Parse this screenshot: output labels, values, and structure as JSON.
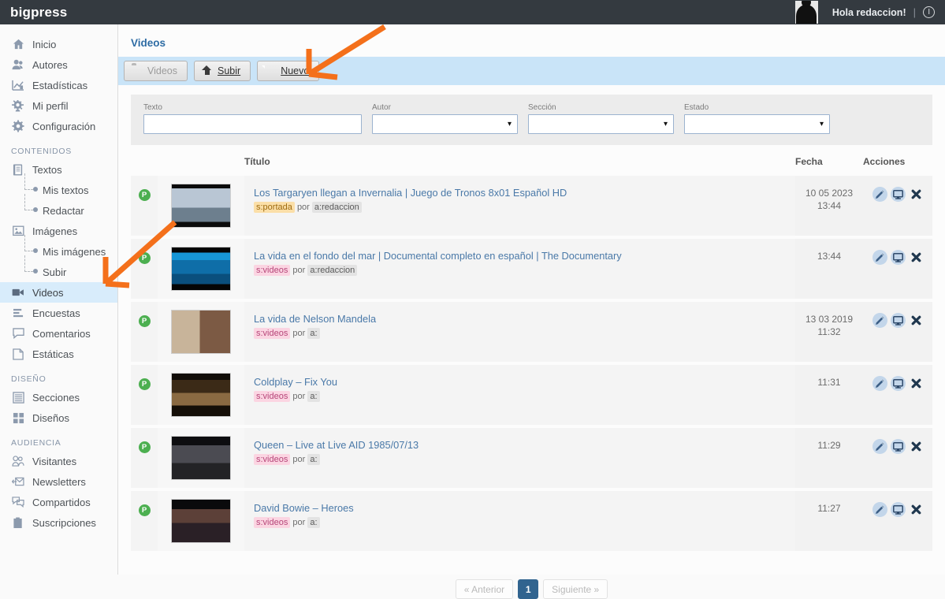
{
  "topbar": {
    "brand": "bigpress",
    "greeting": "Hola redaccion!",
    "separator": "|",
    "avatar_icon": "user-avatar-icon",
    "logout_icon": "power-icon"
  },
  "sidebar": {
    "items": [
      {
        "label": "Inicio",
        "icon": "home-icon",
        "active": false
      },
      {
        "label": "Autores",
        "icon": "users-icon",
        "active": false
      },
      {
        "label": "Estadísticas",
        "icon": "chart-icon",
        "active": false
      },
      {
        "label": "Mi perfil",
        "icon": "gear-user-icon",
        "active": false
      },
      {
        "label": "Configuración",
        "icon": "gear-icon",
        "active": false
      }
    ],
    "groups": [
      {
        "title": "CONTENIDOS",
        "items": [
          {
            "label": "Textos",
            "icon": "book-icon",
            "active": false,
            "sub": false
          },
          {
            "label": "Mis textos",
            "icon": "bullet-icon",
            "active": false,
            "sub": true
          },
          {
            "label": "Redactar",
            "icon": "bullet-icon",
            "active": false,
            "sub": true
          },
          {
            "label": "Imágenes",
            "icon": "image-icon",
            "active": false,
            "sub": false
          },
          {
            "label": "Mis imágenes",
            "icon": "bullet-icon",
            "active": false,
            "sub": true
          },
          {
            "label": "Subir",
            "icon": "bullet-icon",
            "active": false,
            "sub": true
          },
          {
            "label": "Videos",
            "icon": "video-camera-icon",
            "active": true,
            "sub": false
          },
          {
            "label": "Encuestas",
            "icon": "poll-icon",
            "active": false,
            "sub": false
          },
          {
            "label": "Comentarios",
            "icon": "comment-icon",
            "active": false,
            "sub": false
          },
          {
            "label": "Estáticas",
            "icon": "page-icon",
            "active": false,
            "sub": false
          }
        ]
      },
      {
        "title": "DISEÑO",
        "items": [
          {
            "label": "Secciones",
            "icon": "list-icon",
            "active": false,
            "sub": false
          },
          {
            "label": "Diseños",
            "icon": "grid-icon",
            "active": false,
            "sub": false
          }
        ]
      },
      {
        "title": "AUDIENCIA",
        "items": [
          {
            "label": "Visitantes",
            "icon": "visitors-icon",
            "active": false,
            "sub": false
          },
          {
            "label": "Newsletters",
            "icon": "envelope-icon",
            "active": false,
            "sub": false
          },
          {
            "label": "Compartidos",
            "icon": "share-icon",
            "active": false,
            "sub": false
          },
          {
            "label": "Suscripciones",
            "icon": "clipboard-icon",
            "active": false,
            "sub": false
          }
        ]
      }
    ]
  },
  "main": {
    "page_title": "Videos",
    "toolbar": [
      {
        "label": "Videos",
        "icon": "folder-icon",
        "accel": "",
        "disabled": true
      },
      {
        "label": "Subir",
        "icon": "upload-icon",
        "accel": "S",
        "disabled": false
      },
      {
        "label": "Nuevo",
        "icon": "document-icon",
        "accel": "N",
        "disabled": false
      }
    ],
    "filters": [
      {
        "name": "texto",
        "label": "Texto",
        "type": "text",
        "value": "",
        "placeholder": ""
      },
      {
        "name": "autor",
        "label": "Autor",
        "type": "select",
        "value": ""
      },
      {
        "name": "seccion",
        "label": "Sección",
        "type": "select",
        "value": ""
      },
      {
        "name": "estado",
        "label": "Estado",
        "type": "select",
        "value": ""
      }
    ],
    "table": {
      "headers": {
        "state": "",
        "thumb": "",
        "title": "Título",
        "fecha": "Fecha",
        "acciones": "Acciones"
      },
      "rows": [
        {
          "state_badge": "P",
          "thumb": "got-targaryen-winterfell",
          "title": "Los Targaryen llegan a Invernalia | Juego de Tronos 8x01 Español HD",
          "section_tag": "s:portada",
          "section_kind": "portada",
          "by_label": "por",
          "author_tag": "a:redaccion",
          "date": "10 05 2023",
          "time": "13:44"
        },
        {
          "state_badge": "P",
          "thumb": "ocean-shark-documentary",
          "title": "La vida en el fondo del mar | Documental completo en español | The Documentary",
          "section_tag": "s:videos",
          "section_kind": "videos",
          "by_label": "por",
          "author_tag": "a:redaccion",
          "date": "",
          "time": "13:44"
        },
        {
          "state_badge": "P",
          "thumb": "nelson-mandela-portrait",
          "title": "La vida de Nelson Mandela",
          "section_tag": "s:videos",
          "section_kind": "videos",
          "by_label": "por",
          "author_tag": "a:",
          "date": "13 03 2019",
          "time": "11:32"
        },
        {
          "state_badge": "P",
          "thumb": "coldplay-fix-you",
          "title": "Coldplay – Fix You",
          "section_tag": "s:videos",
          "section_kind": "videos",
          "by_label": "por",
          "author_tag": "a:",
          "date": "",
          "time": "11:31"
        },
        {
          "state_badge": "P",
          "thumb": "queen-live-aid",
          "title": "Queen – Live at Live AID 1985/07/13",
          "section_tag": "s:videos",
          "section_kind": "videos",
          "by_label": "por",
          "author_tag": "a:",
          "date": "",
          "time": "11:29"
        },
        {
          "state_badge": "P",
          "thumb": "david-bowie-heroes",
          "title": "David Bowie – Heroes",
          "section_tag": "s:videos",
          "section_kind": "videos",
          "by_label": "por",
          "author_tag": "a:",
          "date": "",
          "time": "11:27"
        }
      ],
      "row_actions": [
        {
          "name": "edit",
          "icon": "pencil-icon"
        },
        {
          "name": "preview",
          "icon": "monitor-icon"
        },
        {
          "name": "delete",
          "icon": "close-x-icon"
        }
      ]
    },
    "pagination": {
      "previous": "« Anterior",
      "current_page": "1",
      "next": "Siguiente »"
    }
  },
  "annotations": {
    "arrow_color": "#f4701b",
    "arrows": [
      {
        "name": "arrow-to-nuevo-button"
      },
      {
        "name": "arrow-to-videos-sidebar"
      }
    ]
  },
  "colors": {
    "topbar_bg": "#343a40",
    "toolbar_bg": "#c9e4f8",
    "active_nav_bg": "#d8ecfb",
    "link_blue": "#4a79a8",
    "title_blue": "#2e6ca4",
    "badge_green": "#4caf50",
    "tag_portada": "#fbdfa8",
    "tag_videos": "#fbd5e2",
    "pager_active": "#31648f",
    "arrow_orange": "#f4701b"
  }
}
